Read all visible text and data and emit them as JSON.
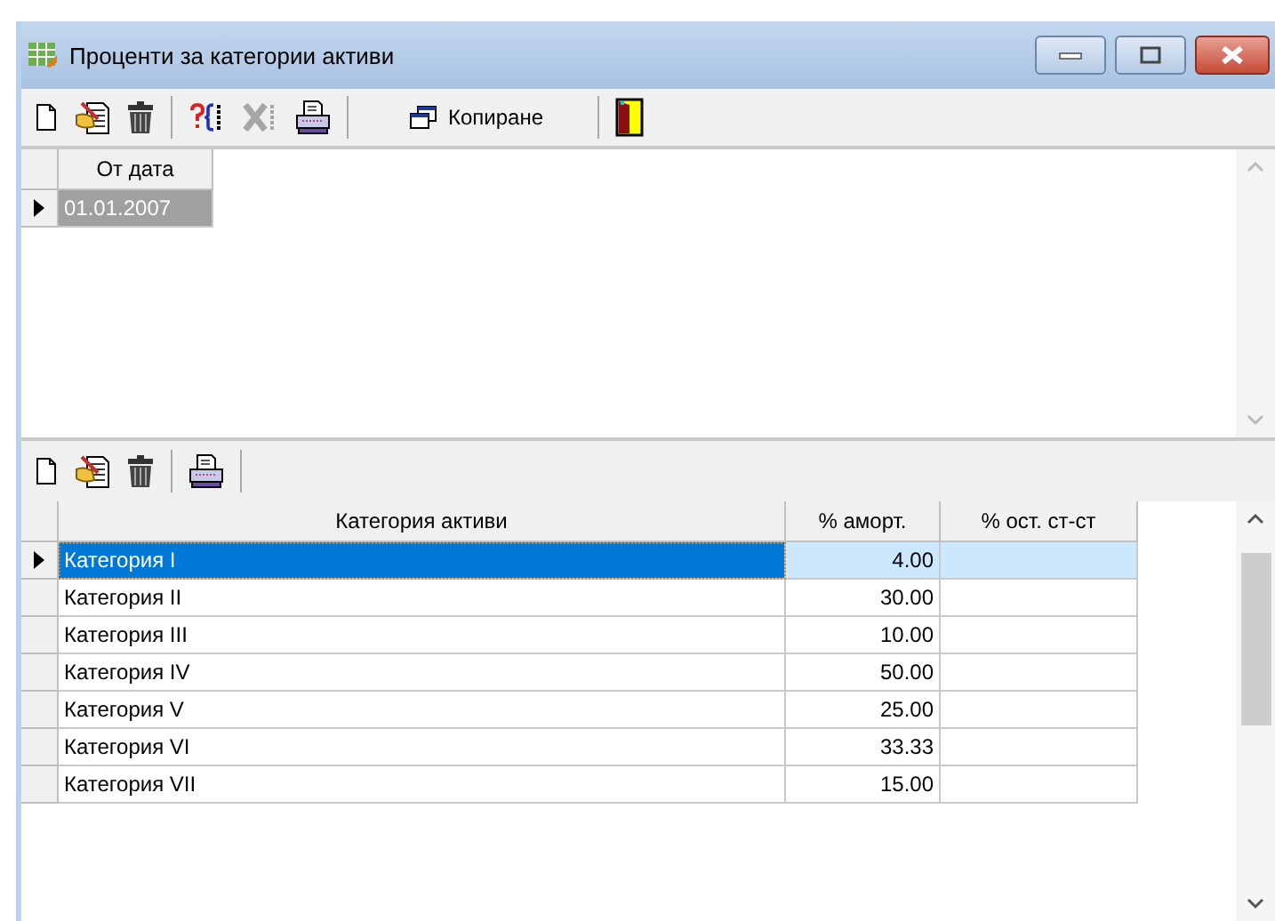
{
  "window": {
    "title": "Проценти за категории активи"
  },
  "toolbar": [
    {
      "kind": "new",
      "disabled": false
    },
    {
      "kind": "edit",
      "disabled": false
    },
    {
      "kind": "delete",
      "disabled": false
    },
    {
      "kind": "separator"
    },
    {
      "kind": "filter",
      "disabled": false
    },
    {
      "kind": "cancel",
      "disabled": true
    },
    {
      "kind": "print",
      "disabled": false
    },
    {
      "kind": "separator"
    },
    {
      "kind": "copy",
      "label": "Копиране",
      "disabled": false
    },
    {
      "kind": "separator"
    },
    {
      "kind": "exit",
      "disabled": false
    }
  ],
  "upper_grid": {
    "columns": [
      "От дата"
    ],
    "rows": [
      {
        "cells": [
          "01.01.2007"
        ],
        "selected": true
      }
    ]
  },
  "lower_toolbar": [
    {
      "kind": "new",
      "disabled": false
    },
    {
      "kind": "edit",
      "disabled": false
    },
    {
      "kind": "delete",
      "disabled": false
    },
    {
      "kind": "separator"
    },
    {
      "kind": "print",
      "disabled": false
    },
    {
      "kind": "separator"
    }
  ],
  "lower_grid": {
    "columns": [
      "Категория активи",
      "% аморт.",
      "% ост. ст-ст"
    ],
    "rows": [
      {
        "cells": [
          "Категория I",
          "4.00",
          ""
        ],
        "selected": true
      },
      {
        "cells": [
          "Категория II",
          "30.00",
          ""
        ],
        "selected": false
      },
      {
        "cells": [
          "Категория III",
          "10.00",
          ""
        ],
        "selected": false
      },
      {
        "cells": [
          "Категория IV",
          "50.00",
          ""
        ],
        "selected": false
      },
      {
        "cells": [
          "Категория V",
          "25.00",
          ""
        ],
        "selected": false
      },
      {
        "cells": [
          "Категория VI",
          "33.33",
          ""
        ],
        "selected": false
      },
      {
        "cells": [
          "Категория VII",
          "15.00",
          ""
        ],
        "selected": false
      }
    ]
  }
}
